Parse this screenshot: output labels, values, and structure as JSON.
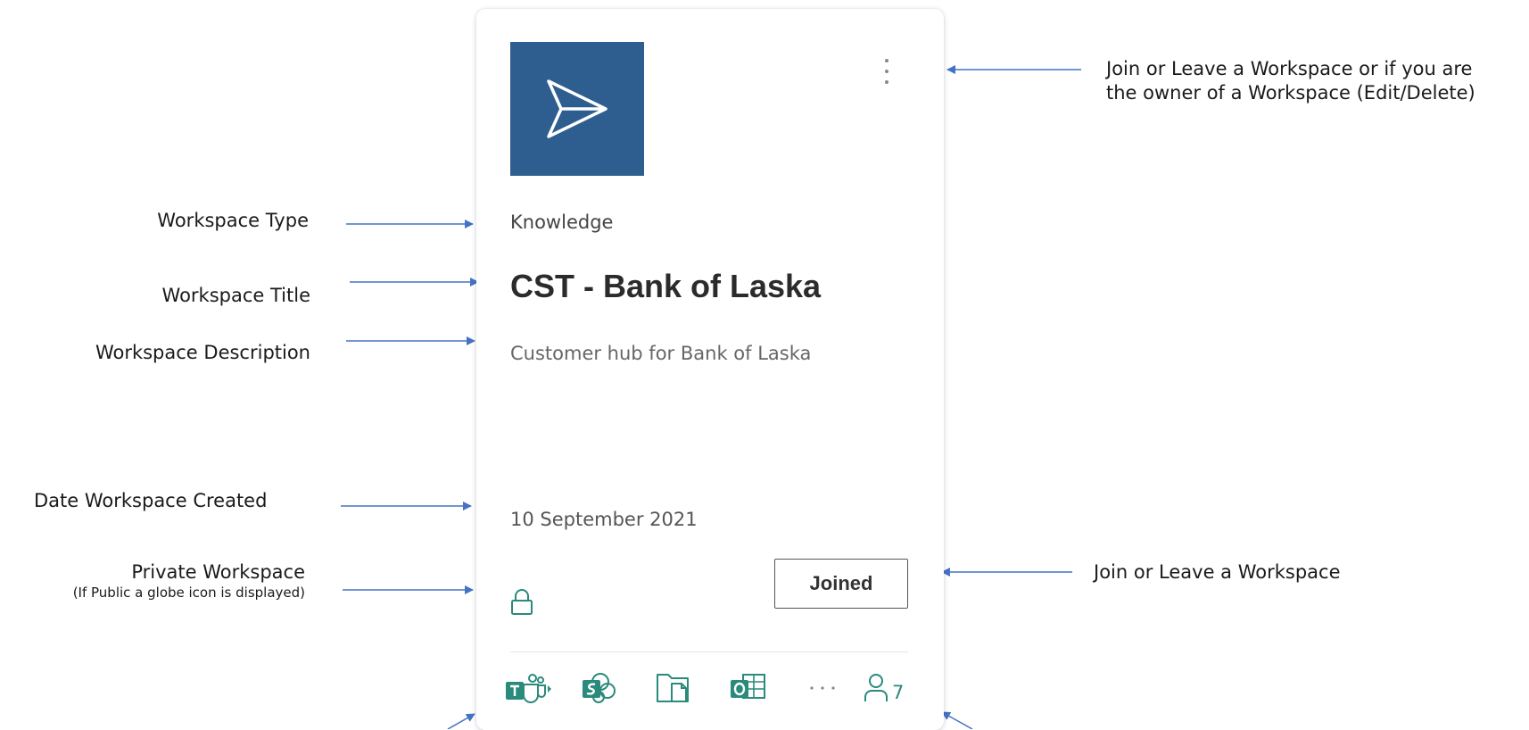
{
  "annotations": {
    "menu_note_line1": "Join or Leave a Workspace or if you are",
    "menu_note_line2": "the owner of a Workspace (Edit/Delete)",
    "workspace_type": "Workspace Type",
    "workspace_title": "Workspace Title",
    "workspace_description": "Workspace Description",
    "date_created": "Date Workspace Created",
    "private_workspace": "Private Workspace",
    "private_workspace_note": "(If Public a globe icon is displayed)",
    "join_leave": "Join or Leave a Workspace"
  },
  "card": {
    "type": "Knowledge",
    "title": "CST - Bank of Laska",
    "description": "Customer hub for Bank of Laska",
    "date": "10 September 2021",
    "join_button_label": "Joined",
    "member_count": "7",
    "logo_color": "#2e5e8f",
    "accent_color": "#2a8a7c",
    "icons": {
      "logo": "send-arrow-icon",
      "menu": "more-vertical-icon",
      "privacy": "lock-icon",
      "apps": [
        "teams-icon",
        "sharepoint-icon",
        "files-icon",
        "outlook-icon",
        "more-horizontal-icon"
      ],
      "members": "person-icon"
    }
  }
}
